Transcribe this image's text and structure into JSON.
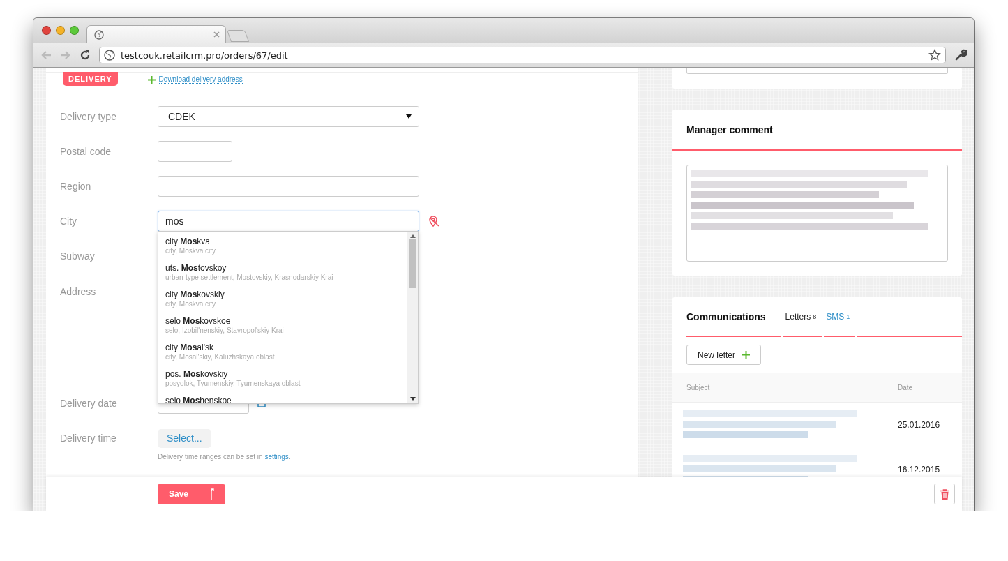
{
  "browser": {
    "url": "testcouk.retailcrm.pro/orders/67/edit"
  },
  "delivery": {
    "badge": "DELIVERY",
    "download_link": "Download delivery address",
    "fields": [
      {
        "kind": "select",
        "label": "Delivery type",
        "value": "CDEK"
      },
      {
        "kind": "short-input",
        "label": "Postal code"
      },
      {
        "kind": "input",
        "label": "Region"
      },
      {
        "kind": "city",
        "label": "City",
        "value": "mos",
        "focused": true,
        "suggestions": [
          {
            "name": "city **Mos**kva",
            "detail": "city, Moskva city"
          },
          {
            "name": "uts. **Mos**tovskoy",
            "detail": "urban-type settlement, Mostovskiy, Krasnodarskiy Krai"
          },
          {
            "name": "city **Mos**kovskiy",
            "detail": "city, Moskva city"
          },
          {
            "name": "selo **Mos**kovskoe",
            "detail": "selo, Izobil'nenskiy, Stavropol'skiy Krai"
          },
          {
            "name": "city **Mos**al'sk",
            "detail": "city, Mosal'skiy, Kaluzhskaya oblast"
          },
          {
            "name": "pos. **Mos**kovskiy",
            "detail": "posyolok, Tyumenskiy, Tyumenskaya oblast"
          },
          {
            "name": "selo **Mos**henskoe"
          }
        ]
      },
      {
        "kind": "plain",
        "label": "Subway"
      },
      {
        "kind": "address",
        "label": "Address"
      },
      {
        "kind": "date",
        "label": "Delivery date"
      },
      {
        "kind": "time",
        "label": "Delivery time",
        "button": "Select...",
        "hint": {
          "before": "Delivery time ranges can be set in",
          "link": "settings",
          "after": "."
        }
      }
    ]
  },
  "manager_comment": {
    "title": "Manager comment"
  },
  "communications": {
    "title": "Communications",
    "tabs": [
      {
        "label": "Letters",
        "count": "8",
        "selected": true
      },
      {
        "label": "SMS",
        "count": "1",
        "selected": false
      }
    ],
    "new_letter": "New letter",
    "columns": [
      "Subject",
      "Date"
    ],
    "rows": [
      {
        "date": "25.01.2016"
      },
      {
        "date": "16.12.2015"
      }
    ]
  },
  "footer": {
    "save": "Save"
  }
}
